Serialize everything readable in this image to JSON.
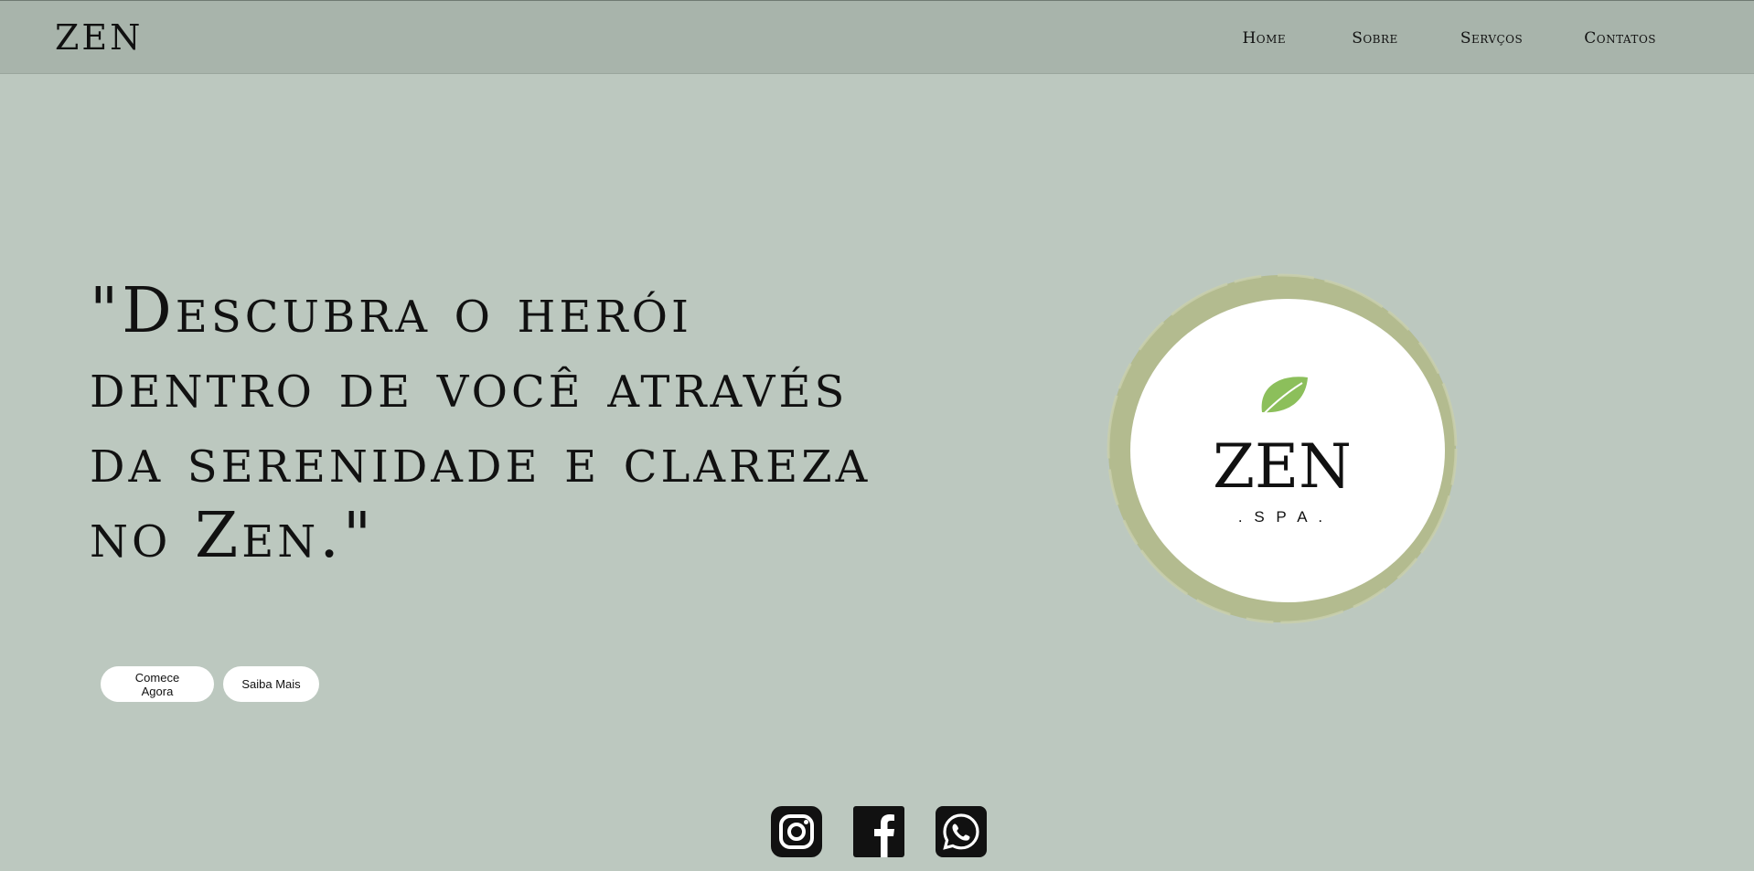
{
  "header": {
    "brand": "ZEN",
    "nav": {
      "home": "Home",
      "sobre": "Sobre",
      "servicos": "Servços",
      "contatos": "Contatos"
    }
  },
  "hero": {
    "quote": "\"Descubra o herói dentro de você através da serenidade e clareza no Zen.\"",
    "buttons": {
      "comece": "Comece Agora",
      "saiba": "Saiba Mais"
    }
  },
  "logo": {
    "title": "ZEN",
    "subtitle": ". S P A .",
    "ring_color": "#b3bb8f",
    "leaf_color": "#8cbf5b"
  },
  "socials": [
    {
      "icon": "instagram-icon"
    },
    {
      "icon": "facebook-icon"
    },
    {
      "icon": "whatsapp-icon"
    }
  ],
  "colors": {
    "background": "#bcc8bf",
    "navbar": "#a8b4ab"
  }
}
